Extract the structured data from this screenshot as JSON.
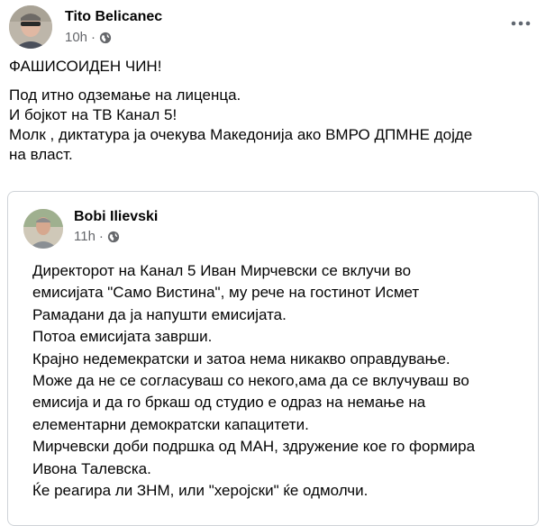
{
  "post": {
    "author": "Tito Belicanec",
    "time": "10h",
    "separator": "·",
    "more_icon": "more-horizontal-icon",
    "lines": [
      "ФАШИСОИДЕН ЧИН!",
      "Под итно одземање на лиценца.",
      "И бојкот на ТВ Канал 5!",
      "Молк , диктатура ја очекува Македонија ако ВМРО ДПМНЕ дојде",
      "на власт."
    ]
  },
  "shared_post": {
    "author": "Bobi Ilievski",
    "time": "11h",
    "separator": "·",
    "lines": [
      "Директорот на Канал 5 Иван Мирчевски се вклучи во",
      "емисијата \"Само Вистина\", му рече на гостинот Исмет",
      "Рамадани да ја напушти емисијата.",
      "Потоа емисијата заврши.",
      "Крајно недемекратски и затоа нема никакво оправдување.",
      "Може да не се согласуваш со некого,ама да се вклучуваш во",
      "емисија и да го бркаш од студио е одраз на немање на",
      "елементарни демократски капацитети.",
      "Мирчевски доби подршка од МАН, здружение кое го формира",
      "Ивона Талевска.",
      "Ќе реагира ли ЗНМ, или \"херојски\" ќе одмолчи."
    ]
  },
  "colors": {
    "text": "#050505",
    "meta": "#65676b",
    "border": "#cfd3d8"
  }
}
